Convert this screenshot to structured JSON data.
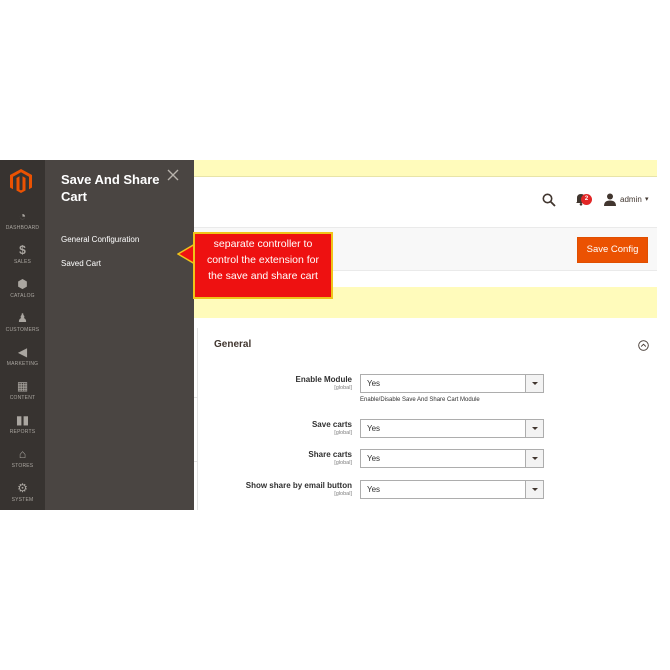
{
  "admin_menu": {
    "items": [
      {
        "label": "DASHBOARD",
        "icon": "dashboard-icon"
      },
      {
        "label": "SALES",
        "icon": "dollar-icon"
      },
      {
        "label": "CATALOG",
        "icon": "box-icon"
      },
      {
        "label": "CUSTOMERS",
        "icon": "person-icon"
      },
      {
        "label": "MARKETING",
        "icon": "megaphone-icon"
      },
      {
        "label": "CONTENT",
        "icon": "layout-icon"
      },
      {
        "label": "REPORTS",
        "icon": "bar-chart-icon"
      },
      {
        "label": "STORES",
        "icon": "store-icon"
      },
      {
        "label": "SYSTEM",
        "icon": "gear-icon"
      }
    ]
  },
  "submenu": {
    "title": "Save And Share Cart",
    "links": [
      "General Configuration",
      "Saved Cart"
    ]
  },
  "header": {
    "notification_count": "2",
    "user_name": "admin"
  },
  "actions": {
    "save_label": "Save Config"
  },
  "callout": {
    "text": "separate controller to control the extension for the save and share cart"
  },
  "section": {
    "title": "General"
  },
  "fields": [
    {
      "label": "Enable Module",
      "scope": "[global]",
      "value": "Yes",
      "note": "Enable/Disable Save And Share Cart Module"
    },
    {
      "label": "Save carts",
      "scope": "[global]",
      "value": "Yes"
    },
    {
      "label": "Share carts",
      "scope": "[global]",
      "value": "Yes"
    },
    {
      "label": "Show share by email button",
      "scope": "[global]",
      "value": "Yes"
    }
  ],
  "colors": {
    "accent": "#eb5202",
    "menu_bg": "#373330",
    "submenu_bg": "#4a4542",
    "notice_bg": "#fffbbb",
    "callout_bg": "#ee1111"
  }
}
